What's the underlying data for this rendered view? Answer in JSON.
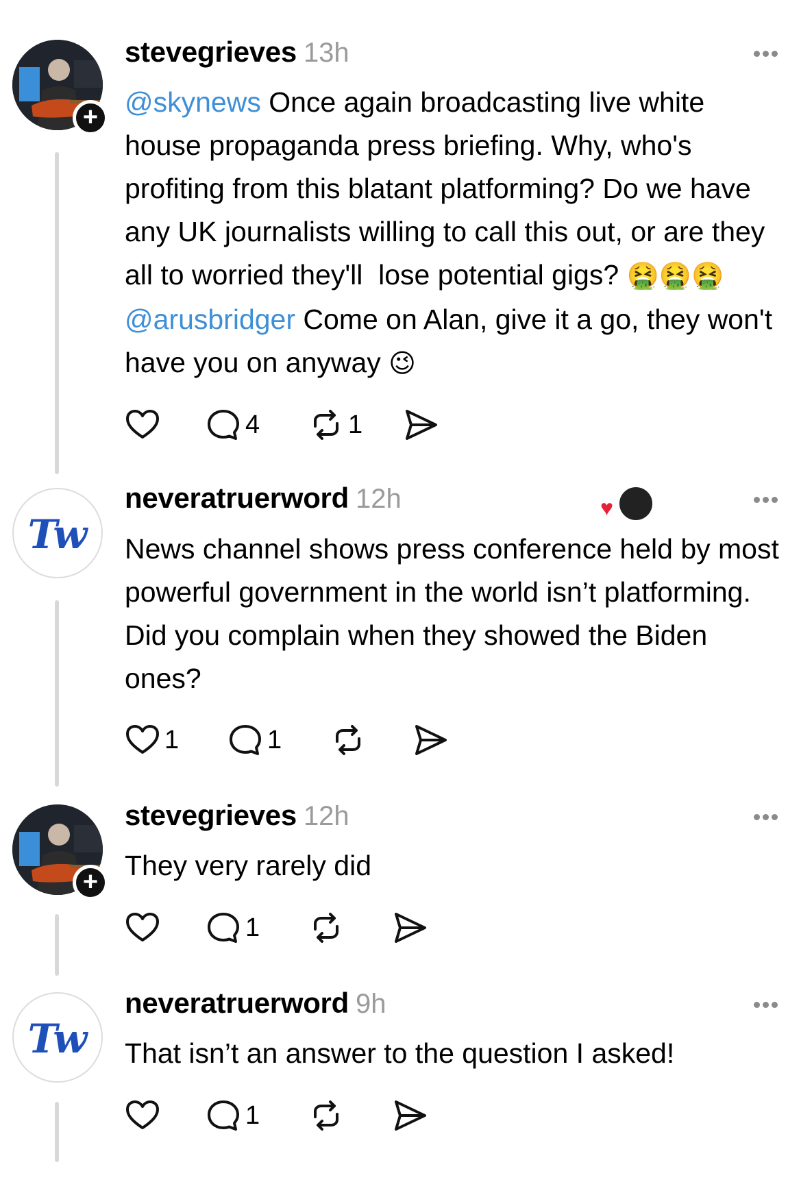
{
  "posts": [
    {
      "username": "stevegrieves",
      "time": "13h",
      "text_parts": {
        "mention1": "@skynews",
        "p1": " Once again broadcasting live white house propaganda press briefing. Why, who's profiting from this blatant platforming? Do we have any UK journalists willing to call this out, or are they all to worried they'll  lose potential gigs? ",
        "emoji1": "🤮🤮🤮",
        "mention2": "@arusbridger",
        "p2": " Come on Alan, give it a go, they won't have you on anyway ",
        "emoji2": "😉"
      },
      "replies": "4",
      "reposts": "1"
    },
    {
      "username": "neveratruerword",
      "time": "12h",
      "text": "News channel shows press conference held by most powerful government in the world isn’t platforming. Did you complain when they showed the Biden ones?",
      "likes": "1",
      "replies": "1"
    },
    {
      "username": "stevegrieves",
      "time": "12h",
      "text": "They very rarely did",
      "replies": "1"
    },
    {
      "username": "neveratruerword",
      "time": "9h",
      "text": "That isn’t an answer to the question I asked!",
      "replies": "1"
    }
  ],
  "avatar_plus": "+",
  "tw_logo": "Tw",
  "colors": {
    "mention": "#3f8fd6",
    "time": "#9a9a9a",
    "thread_line": "#d8d8d8",
    "heart": "#e8213a"
  },
  "icons": [
    "heart-icon",
    "comment-icon",
    "repost-icon",
    "share-icon",
    "more-icon",
    "plus-icon"
  ]
}
